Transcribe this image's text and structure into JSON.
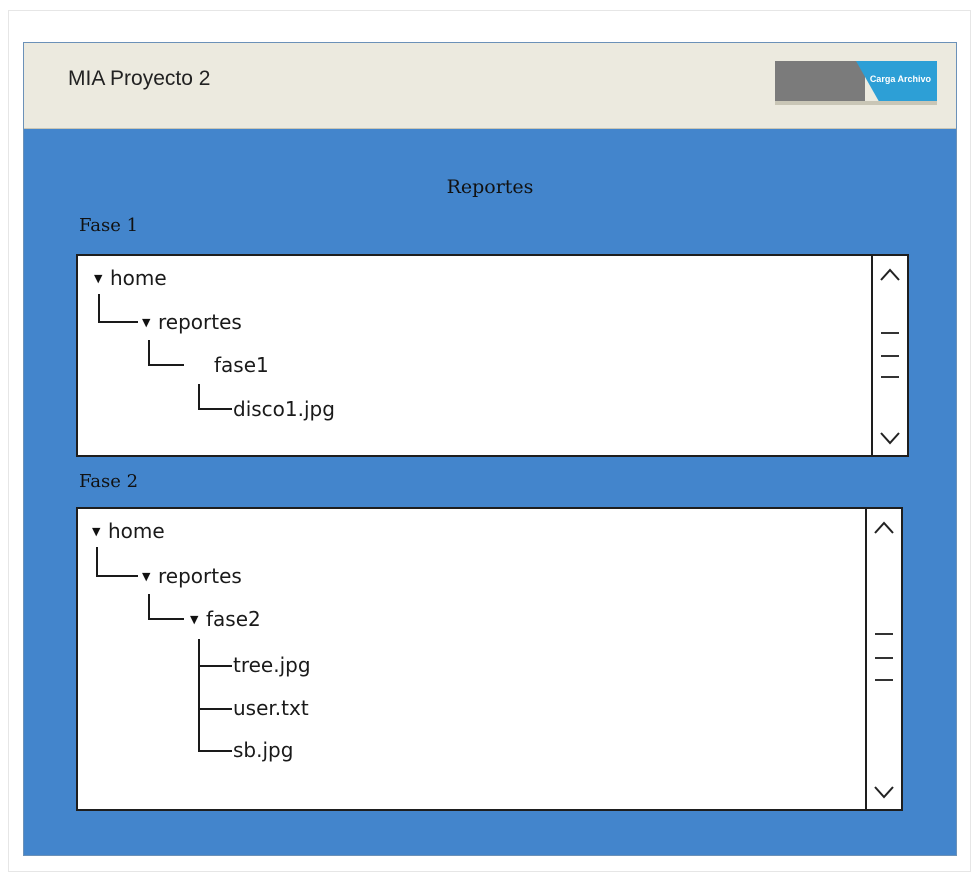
{
  "app": {
    "title": "MIA Proyecto 2"
  },
  "header": {
    "upload_button_label": "Carga Archivo"
  },
  "main": {
    "heading": "Reportes",
    "phases": [
      {
        "label": "Fase 1",
        "tree": {
          "root": "home",
          "folder": "reportes",
          "subfolder": "fase1",
          "files": [
            "disco1.jpg"
          ]
        }
      },
      {
        "label": "Fase 2",
        "tree": {
          "root": "home",
          "folder": "reportes",
          "subfolder": "fase2",
          "files": [
            "tree.jpg",
            "user.txt",
            "sb.jpg"
          ]
        }
      }
    ]
  },
  "icons": {
    "expanded": "triangle-down-icon",
    "scroll_up": "chevron-up-icon",
    "scroll_down": "chevron-down-icon"
  },
  "colors": {
    "panel_background": "#4385cc",
    "titlebar_background": "#eceadf",
    "upload_button_blue": "#2d9fd6",
    "upload_button_grey": "#7b7b7b"
  }
}
